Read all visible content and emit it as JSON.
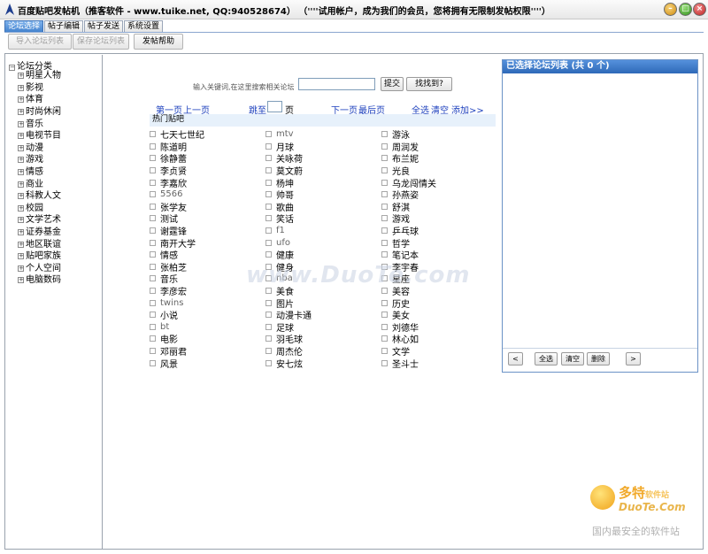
{
  "window": {
    "title": "百度贴吧发帖机（推客软件 - www.tuike.net, QQ:940528674）   （''''试用帐户，成为我们的会员，您将拥有无限制发帖权限''''）",
    "minimize_label": "–",
    "maximize_label": "□",
    "close_label": "×"
  },
  "tabs": [
    "论坛选择",
    "帖子编辑",
    "帖子发送",
    "系统设置"
  ],
  "toolbar": {
    "import_label": "导入论坛列表",
    "save_label": "保存论坛列表",
    "help_label": "发帖帮助"
  },
  "tree": {
    "root": "论坛分类",
    "items": [
      "明星人物",
      "影视",
      "体育",
      "时尚休闲",
      "音乐",
      "电视节目",
      "动漫",
      "游戏",
      "情感",
      "商业",
      "科教人文",
      "校园",
      "文学艺术",
      "证券基金",
      "地区联谊",
      "贴吧家族",
      "个人空间",
      "电脑数码"
    ]
  },
  "search": {
    "prompt": "输入关键词,在这里搜索相关论坛",
    "value": "",
    "submit_label": "提交",
    "find_label": "找找到?"
  },
  "pager": {
    "first": "第一页",
    "prev": "上一页",
    "jump": "跳至",
    "page_value": "",
    "page_unit": "页",
    "next": "下一页",
    "last": "最后页",
    "select_all": "全选",
    "clear": "清空",
    "add": "添加>>"
  },
  "group": {
    "header": "热门贴吧",
    "columns": [
      [
        "七天七世纪",
        "陈道明",
        "徐静蕾",
        "李贞贤",
        "李嘉欣",
        "5566",
        "张学友",
        "测试",
        "谢霆锋",
        "南开大学",
        "情感",
        "张柏芝",
        "音乐",
        "李彦宏",
        "twins",
        "小说",
        "bt",
        "电影",
        "邓丽君",
        "风景"
      ],
      [
        "mtv",
        "月球",
        "关咏荷",
        "莫文蔚",
        "杨坤",
        "帅哥",
        "歌曲",
        "笑话",
        "f1",
        "ufo",
        "健康",
        "健身",
        "nba",
        "美食",
        "图片",
        "动漫卡通",
        "足球",
        "羽毛球",
        "周杰伦",
        "安七炫"
      ],
      [
        "游泳",
        "周润发",
        "布兰妮",
        "光良",
        "乌龙闯情关",
        "孙燕姿",
        "舒淇",
        "游戏",
        "乒乓球",
        "哲学",
        "笔记本",
        "李宇春",
        "星座",
        "美容",
        "历史",
        "美女",
        "刘德华",
        "林心如",
        "文学",
        "圣斗士"
      ]
    ]
  },
  "selected_panel": {
    "title": "已选择论坛列表 (共 0 个)",
    "items": [],
    "prev_label": "<",
    "select_all_label": "全选",
    "clear_label": "清空",
    "delete_label": "删除",
    "next_label": ">"
  },
  "watermarks": {
    "center": "www.DuoTe.com",
    "brand": "多特",
    "brand_suffix": "软件站",
    "domain": "DuoTe.Com",
    "slogan": "国内最安全的软件站"
  },
  "colors": {
    "accent": "#3f7fcc",
    "link": "#1b3fbd",
    "panel_header": "#2e69b8",
    "group_header_bg": "#e7f1fb"
  }
}
